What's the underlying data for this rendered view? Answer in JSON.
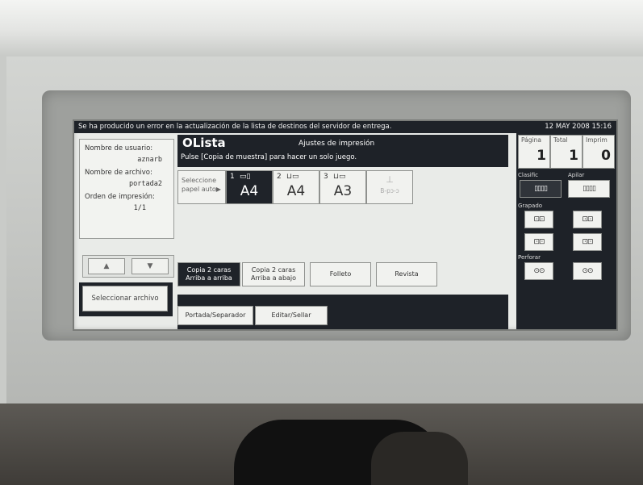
{
  "message_bar": {
    "message": "Se ha producido un error en la actualización de la lista de destinos del servidor de entrega.",
    "datetime": "12 MAY 2008 15:16"
  },
  "info": {
    "user_label": "Nombre de usuario:",
    "user_value": "aznarb",
    "file_label": "Nombre de archivo:",
    "file_value": "portada2",
    "order_label": "Orden de impresión:",
    "order_value": "1/1"
  },
  "scroll": {
    "up": "▲",
    "down": "▼"
  },
  "select_file_label": "Seleccionar archivo",
  "header": {
    "status": "OLista",
    "title": "Ajustes de impresión",
    "hint": "Pulse [Copia de muestra] para hacer un solo juego."
  },
  "trays": [
    {
      "label": "Seleccione papel auto▶"
    },
    {
      "num": "1",
      "size": "A4",
      "icon": "▭▯"
    },
    {
      "num": "2",
      "size": "A4",
      "icon": "⊔▭"
    },
    {
      "num": "3",
      "size": "A3",
      "icon": "⊔▭"
    },
    {
      "bypass": "B-pɔ-ɔ"
    }
  ],
  "duplex_options": [
    {
      "line1": "Copia 2 caras",
      "line2": "Arriba a arriba",
      "selected": true
    },
    {
      "line1": "Copia 2 caras",
      "line2": "Arriba a abajo"
    },
    {
      "line1": "Folleto"
    },
    {
      "line1": "Revista"
    }
  ],
  "bottom_buttons": [
    "Portada/Separador",
    "Editar/Sellar"
  ],
  "counters": [
    {
      "label": "Página",
      "value": "1"
    },
    {
      "label": "Total",
      "value": "1"
    },
    {
      "label": "Imprim",
      "value": "0"
    }
  ],
  "sections": {
    "sort": "Clasific",
    "stack": "Apilar",
    "staple": "Grapado",
    "punch": "Perforar"
  },
  "finishing_icons": {
    "sort": "▯▯▯▯",
    "stack": "▯▯▯▯",
    "staple": "⊡⊡",
    "punch": "⊙⊙"
  }
}
